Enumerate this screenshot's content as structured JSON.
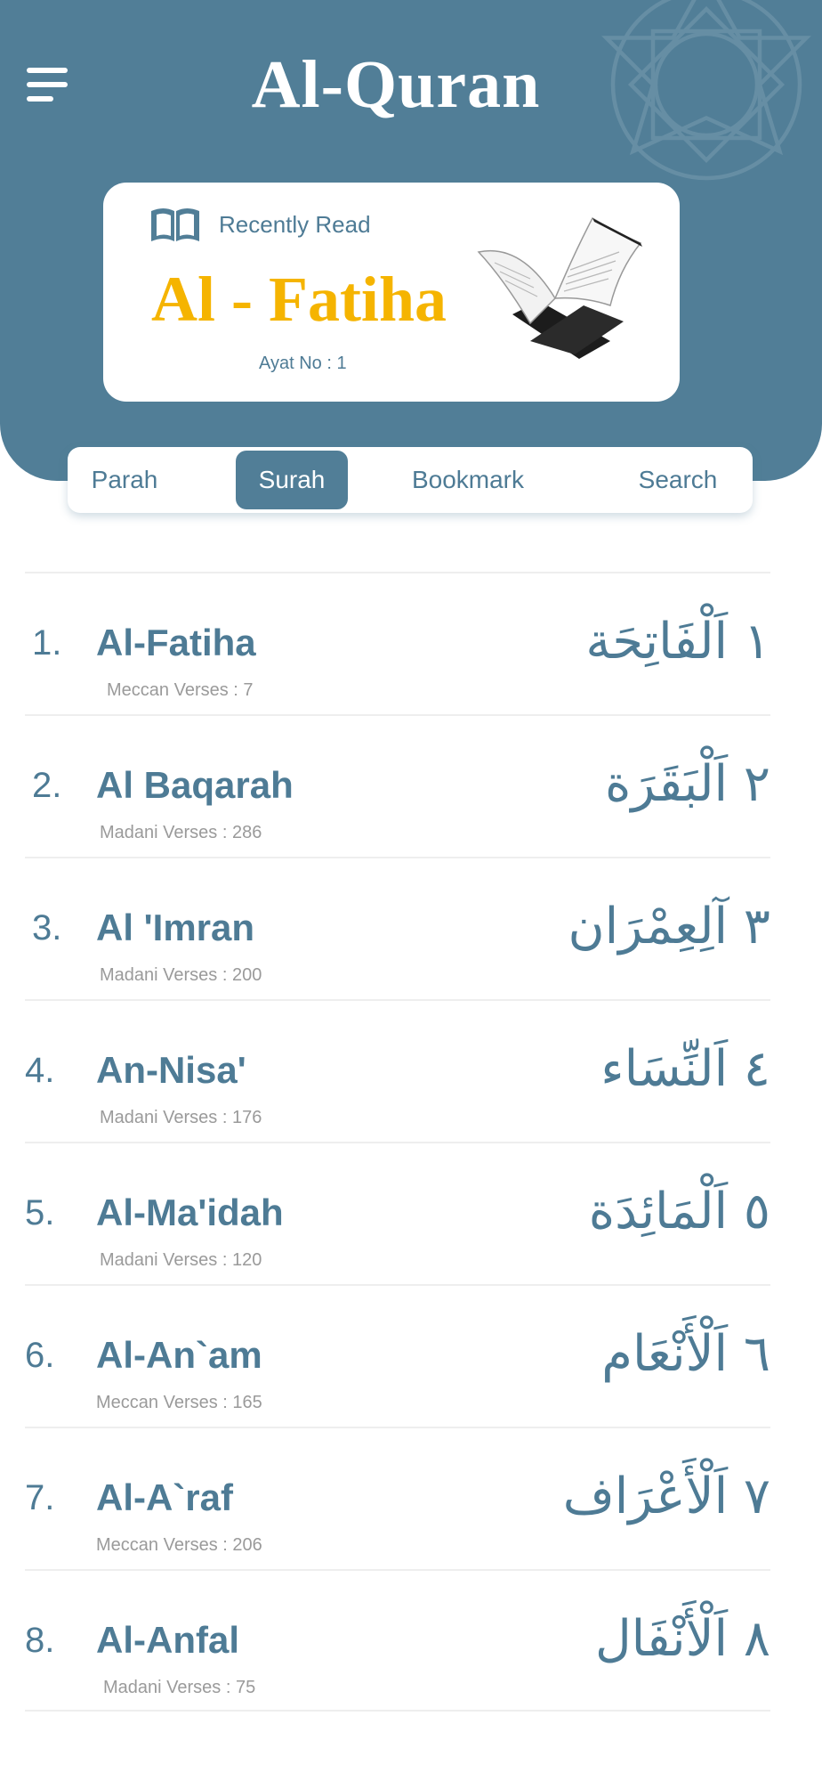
{
  "app": {
    "title": "Al-Quran"
  },
  "recent": {
    "label": "Recently Read",
    "surah": "Al - Fatiha",
    "ayat": "Ayat No : 1"
  },
  "tabs": [
    {
      "label": "Parah",
      "active": false
    },
    {
      "label": "Surah",
      "active": true
    },
    {
      "label": "Bookmark",
      "active": false
    },
    {
      "label": "Search",
      "active": false
    }
  ],
  "surahs": [
    {
      "number": "1.",
      "name": "Al-Fatiha",
      "meta": "Meccan Verses : 7",
      "arabic": "١ اَلْفَاتِحَة"
    },
    {
      "number": "2.",
      "name": "Al Baqarah",
      "meta": "Madani Verses : 286",
      "arabic": "٢ اَلْبَقَرَة"
    },
    {
      "number": "3.",
      "name": "Al 'Imran",
      "meta": "Madani Verses : 200",
      "arabic": "٣ آلِعِمْرَان"
    },
    {
      "number": "4.",
      "name": "An-Nisa'",
      "meta": "Madani Verses : 176",
      "arabic": "٤ اَلنِّسَاء"
    },
    {
      "number": "5.",
      "name": "Al-Ma'idah",
      "meta": "Madani Verses : 120",
      "arabic": "٥ اَلْمَائِدَة"
    },
    {
      "number": "6.",
      "name": "Al-An`am",
      "meta": "Meccan Verses : 165",
      "arabic": "٦ اَلْأَنْعَام"
    },
    {
      "number": "7.",
      "name": "Al-A`raf",
      "meta": "Meccan Verses : 206",
      "arabic": "٧ اَلْأَعْرَاف"
    },
    {
      "number": "8.",
      "name": "Al-Anfal",
      "meta": "Madani Verses : 75",
      "arabic": "٨ اَلْأَنْفَال"
    }
  ],
  "colors": {
    "primary": "#517e97",
    "accent": "#f5b400",
    "muted": "#9a9a9a"
  },
  "icons": {
    "menu": "hamburger-icon",
    "recent": "open-book-icon",
    "image": "quran-on-stand"
  }
}
